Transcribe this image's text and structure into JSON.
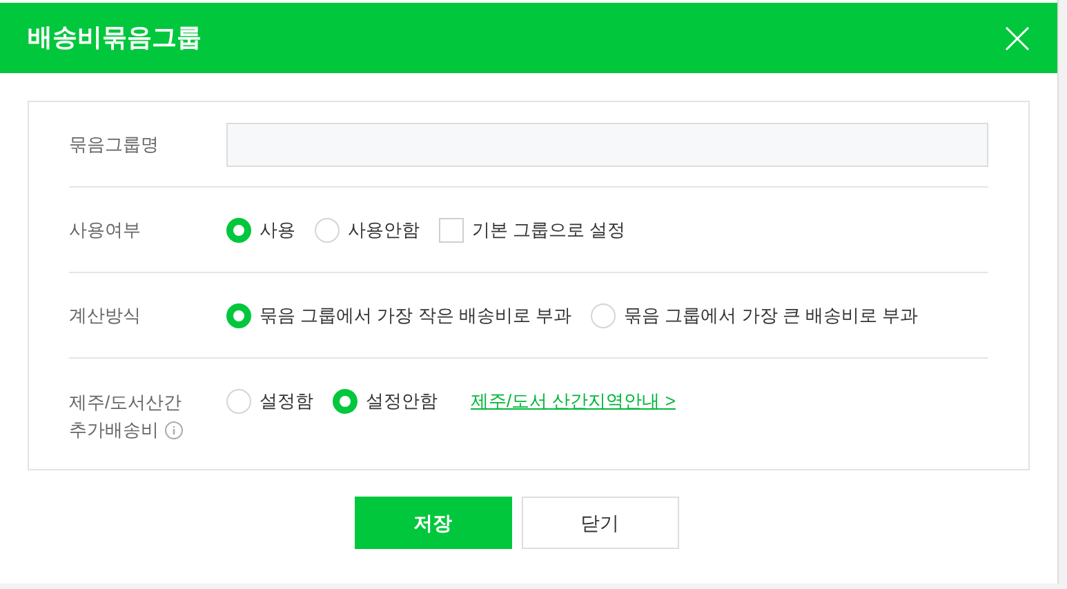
{
  "dialog": {
    "title": "배송비묶음그룹"
  },
  "rows": [
    {
      "kind": "input",
      "label": [
        "묶음그룹명"
      ],
      "info": false,
      "value": ""
    },
    {
      "kind": "options",
      "label": [
        "사용여부"
      ],
      "info": false,
      "options": [
        {
          "kind": "radio",
          "label": "사용",
          "selected": true
        },
        {
          "kind": "radio",
          "label": "사용안함",
          "selected": false
        },
        {
          "kind": "checkbox",
          "label": "기본 그룹으로 설정",
          "checked": false
        }
      ]
    },
    {
      "kind": "options",
      "label": [
        "계산방식"
      ],
      "info": false,
      "options": [
        {
          "kind": "radio",
          "label": "묶음 그룹에서 가장 작은 배송비로 부과",
          "selected": true
        },
        {
          "kind": "radio",
          "label": "묶음 그룹에서 가장 큰 배송비로 부과",
          "selected": false
        }
      ]
    },
    {
      "kind": "options",
      "label": [
        "제주/도서산간",
        "추가배송비"
      ],
      "info": true,
      "options": [
        {
          "kind": "radio",
          "label": "설정함",
          "selected": false
        },
        {
          "kind": "radio",
          "label": "설정안함",
          "selected": true
        },
        {
          "kind": "link",
          "label": "제주/도서 산간지역안내 >"
        }
      ]
    }
  ],
  "buttons": [
    {
      "kind": "primary",
      "label": "저장"
    },
    {
      "kind": "secondary",
      "label": "닫기"
    }
  ]
}
